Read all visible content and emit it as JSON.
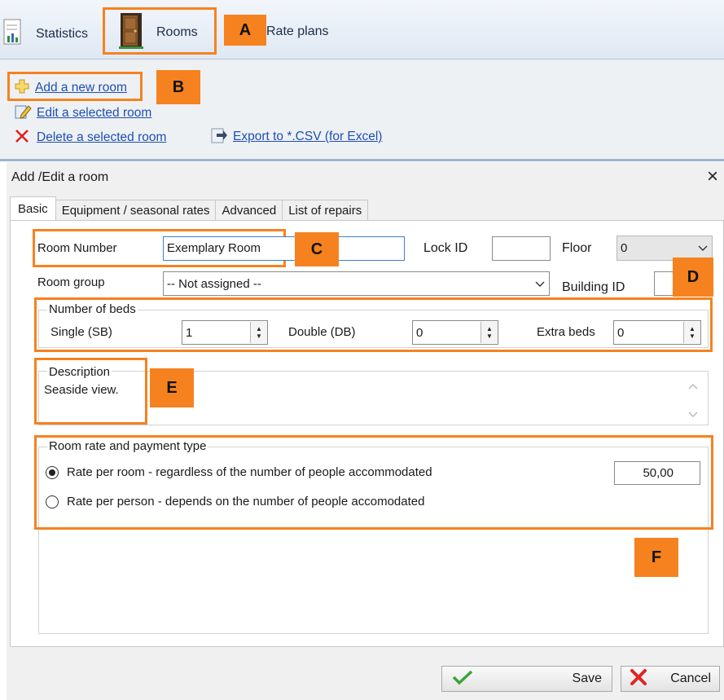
{
  "toolbar": {
    "statistics_label": "Statistics",
    "rooms_label": "Rooms",
    "rate_plans_label": "Rate plans"
  },
  "actions": {
    "add_room": "Add a new room",
    "edit_room": "Edit a selected room",
    "delete_room": "Delete a selected room",
    "export_csv": "Export to *.CSV (for Excel)"
  },
  "markers": {
    "a": "A",
    "b": "B",
    "c": "C",
    "d": "D",
    "e": "E",
    "f": "F"
  },
  "dialog": {
    "title": "Add /Edit a room",
    "close": "×",
    "tabs": [
      "Basic",
      "Equipment / seasonal rates",
      "Advanced",
      "List of repairs"
    ],
    "room_number_label": "Room Number",
    "room_number_value": "Exemplary Room",
    "lock_id_label": "Lock ID",
    "lock_id_value": "",
    "floor_label": "Floor",
    "floor_value": "0",
    "room_group_label": "Room group",
    "room_group_value": "-- Not assigned --",
    "building_id_label": "Building ID",
    "beds": {
      "legend": "Number of beds",
      "single_label": "Single (SB)",
      "single_value": "1",
      "double_label": "Double (DB)",
      "double_value": "0",
      "extra_label": "Extra beds",
      "extra_value": "0"
    },
    "description": {
      "legend": "Description",
      "text": "Seaside view."
    },
    "rate": {
      "legend": "Room rate and payment type",
      "option_room": "Rate per room - regardless of the number of people accommodated",
      "option_person": "Rate per person - depends on the number of people accomodated",
      "selected": "room",
      "price": "50,00"
    },
    "save_label": "Save",
    "cancel_label": "Cancel"
  },
  "colors": {
    "accent": "#f5821f",
    "link": "#1f4fb3"
  }
}
